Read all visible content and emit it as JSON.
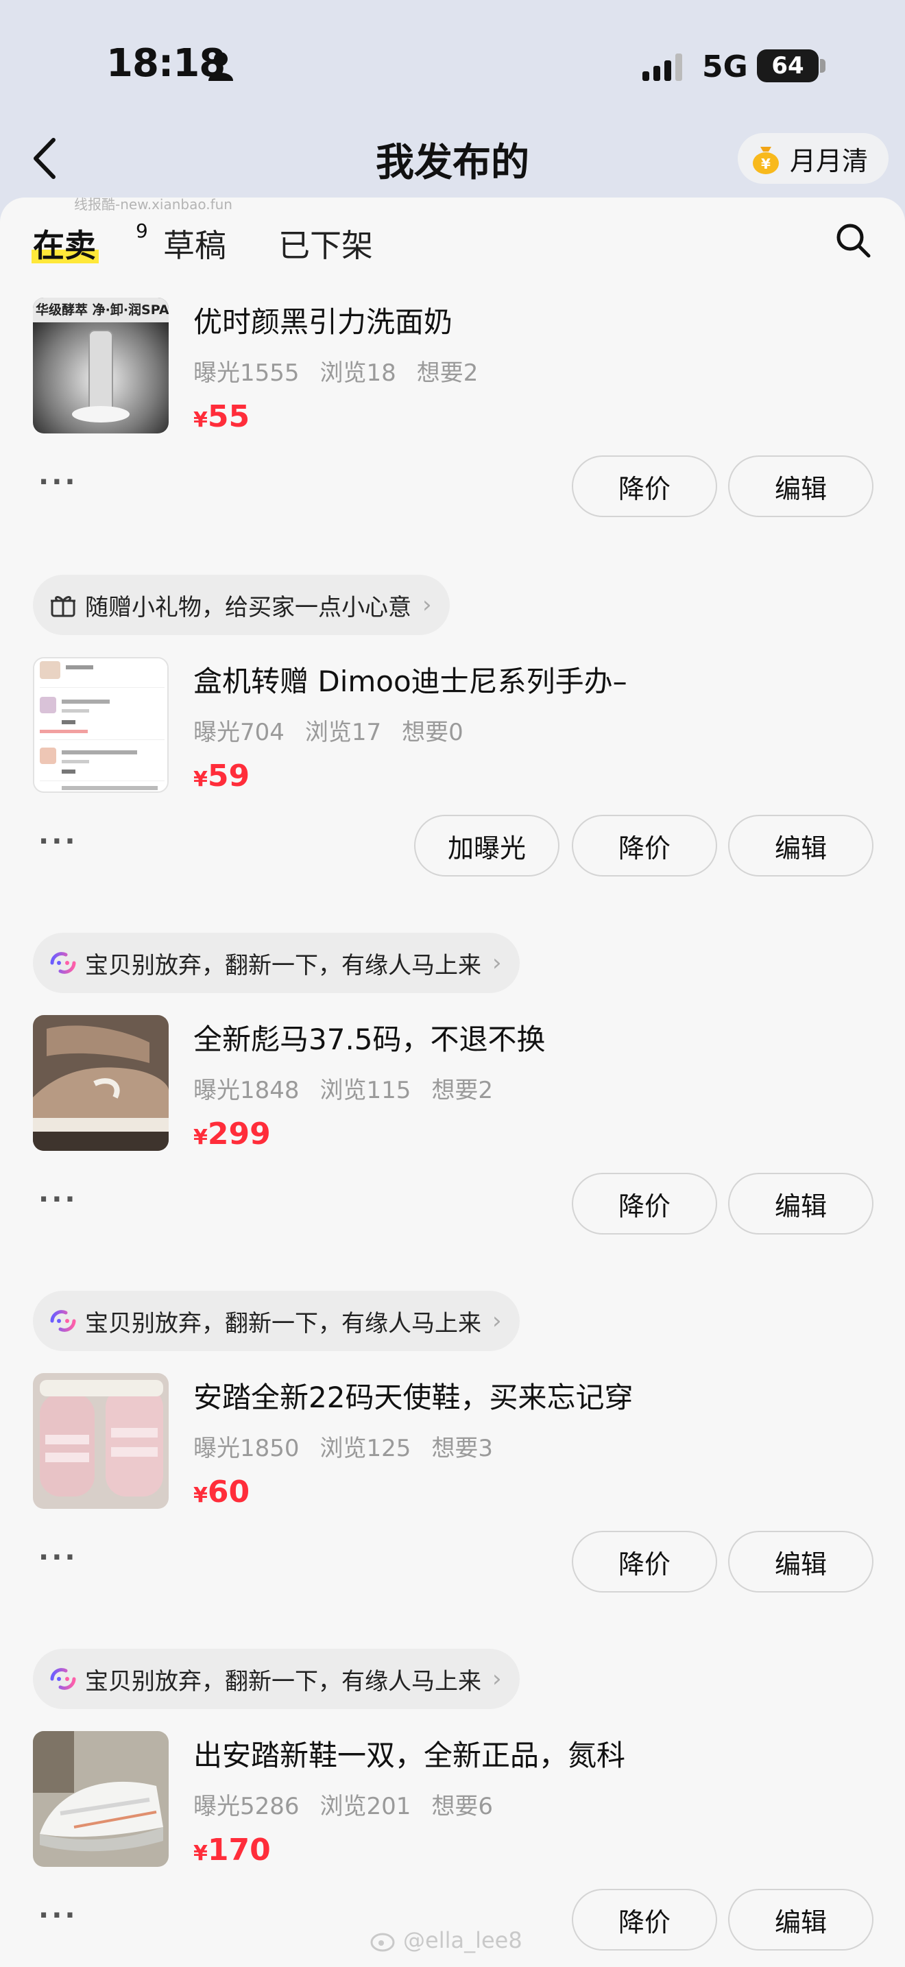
{
  "status_bar": {
    "time": "18:18",
    "network": "5G",
    "battery": "64"
  },
  "nav": {
    "title": "我发布的",
    "right_button": "月月清"
  },
  "watermark_top": "线报酷-new.xianbao.fun",
  "tabs": {
    "on_sale": "在卖",
    "on_sale_count": "9",
    "drafts": "草稿",
    "off_shelf": "已下架"
  },
  "items": [
    {
      "promo": "",
      "title": "优时颜黑引力洗面奶",
      "exposure": "曝光1555",
      "views": "浏览18",
      "wants": "想要2",
      "currency": "¥",
      "price": "55",
      "thumb_text": "华级酵萃 净·卸·润SPA",
      "buttons": [
        "降价",
        "编辑"
      ]
    },
    {
      "promo": "随赠小礼物，给买家一点小心意",
      "title": "盒机转赠  Dimoo迪士尼系列手办–",
      "exposure": "曝光704",
      "views": "浏览17",
      "wants": "想要0",
      "currency": "¥",
      "price": "59",
      "buttons": [
        "加曝光",
        "降价",
        "编辑"
      ]
    },
    {
      "promo": "宝贝别放弃，翻新一下，有缘人马上来",
      "title": "全新彪马37.5码，不退不换",
      "exposure": "曝光1848",
      "views": "浏览115",
      "wants": "想要2",
      "currency": "¥",
      "price": "299",
      "buttons": [
        "降价",
        "编辑"
      ]
    },
    {
      "promo": "宝贝别放弃，翻新一下，有缘人马上来",
      "title": "安踏全新22码天使鞋，买来忘记穿",
      "exposure": "曝光1850",
      "views": "浏览125",
      "wants": "想要3",
      "currency": "¥",
      "price": "60",
      "buttons": [
        "降价",
        "编辑"
      ]
    },
    {
      "promo": "宝贝别放弃，翻新一下，有缘人马上来",
      "title": "出安踏新鞋一双，全新正品，氮科",
      "exposure": "曝光5286",
      "views": "浏览201",
      "wants": "想要6",
      "currency": "¥",
      "price": "170",
      "buttons": [
        "降价",
        "编辑"
      ]
    }
  ],
  "more_label": "···",
  "watermark_bottom": "@ella_lee8",
  "colors": {
    "price": "#ff2d3a",
    "highlight": "#ffe83a",
    "background": "#f7f7f7"
  }
}
